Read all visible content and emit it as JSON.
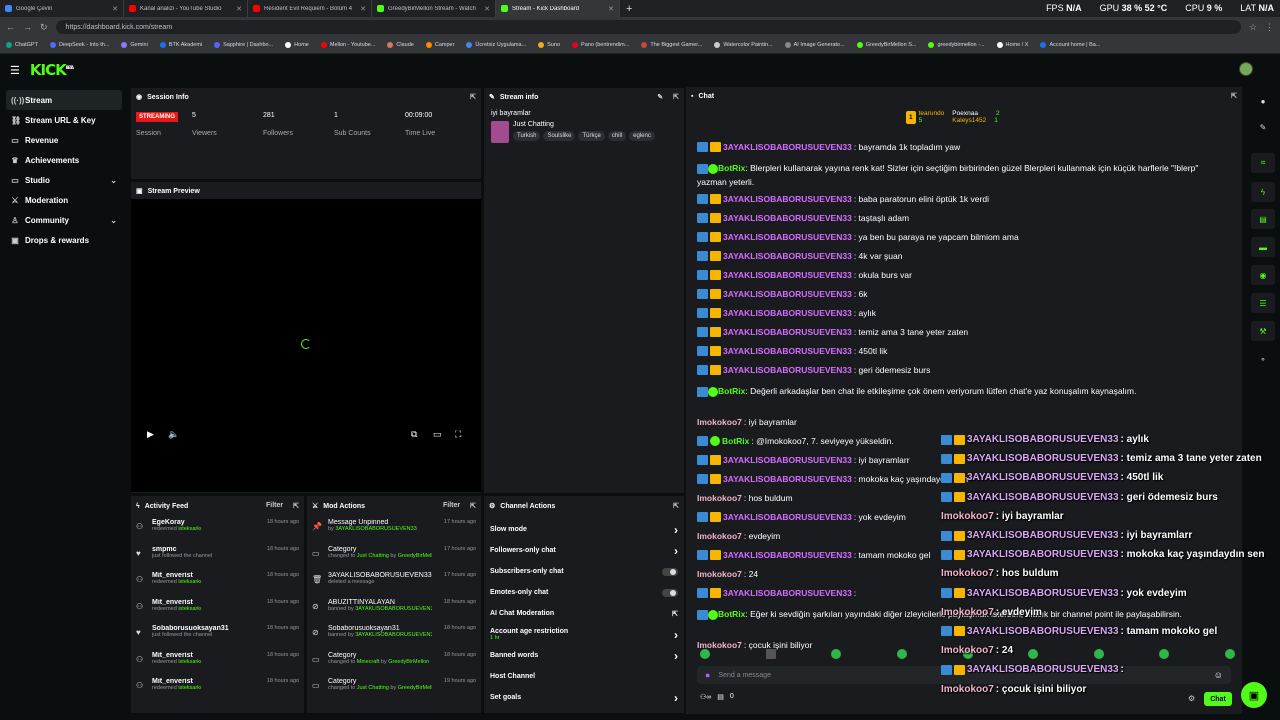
{
  "browser": {
    "tabs": [
      {
        "title": "Google Çeviri",
        "color": "#4285f4",
        "active": false
      },
      {
        "title": "Kanal analizi - YouTube Studio",
        "color": "#ff0000",
        "active": false
      },
      {
        "title": "Resident Evil Requiem - Bölüm 4",
        "color": "#ff0000",
        "active": false
      },
      {
        "title": "GreedyBirMellon Stream - Watch",
        "color": "#53fc18",
        "active": false
      },
      {
        "title": "Stream - Kick Dashboard",
        "color": "#53fc18",
        "active": true
      }
    ],
    "new_tab": "+",
    "url": "https://dashboard.kick.com/stream",
    "bookmarks": [
      "ChatGPT",
      "DeepSeek - Into th...",
      "Gemini",
      "BTK Akademi",
      "Sapphire | Dashbo...",
      "Home",
      "Mellon - Youtube...",
      "Claude",
      "Camper",
      "Ücretsiz Uygulama...",
      "Suno",
      "Pano (bentrendim...",
      "The Biggest Gamer...",
      "Watercolor Paintin...",
      "AI Image Generato...",
      "GreedyBirMellon S...",
      "greedybirmellon -...",
      "Home / X",
      "Account home | Ba..."
    ]
  },
  "system_stats": {
    "fps_label": "FPS",
    "fps": "N/A",
    "gpu_label": "GPU",
    "gpu": "38 % 52 °C",
    "cpu_label": "CPU",
    "cpu": "9 %",
    "lat_label": "LAT",
    "lat": "N/A"
  },
  "brand": {
    "logo": "KICK",
    "beta": "BETA",
    "accent": "#53fc18"
  },
  "sidebar": {
    "items": [
      {
        "label": "Stream",
        "icon": "broadcast-icon",
        "glyph": "((·))",
        "active": true
      },
      {
        "label": "Stream URL & Key",
        "icon": "link-icon",
        "glyph": "⛓"
      },
      {
        "label": "Revenue",
        "icon": "wallet-icon",
        "glyph": "▭"
      },
      {
        "label": "Achievements",
        "icon": "trophy-icon",
        "glyph": "♛"
      },
      {
        "label": "Studio",
        "icon": "video-icon",
        "glyph": "▭",
        "expandable": true
      },
      {
        "label": "Moderation",
        "icon": "sword-icon",
        "glyph": "⚔"
      },
      {
        "label": "Community",
        "icon": "people-icon",
        "glyph": "♙",
        "expandable": true
      },
      {
        "label": "Drops & rewards",
        "icon": "gift-icon",
        "glyph": "▣"
      }
    ]
  },
  "session_info": {
    "title": "Session Info",
    "status": "STREAMING",
    "status_label": "Session",
    "stats": [
      {
        "value": "5",
        "label": "Viewers"
      },
      {
        "value": "281",
        "label": "Followers"
      },
      {
        "value": "1",
        "label": "Sub Counts"
      },
      {
        "value": "00:09:00",
        "label": "Time Live"
      }
    ]
  },
  "stream_info": {
    "title": "Stream info",
    "stream_title": "iyi bayramlar",
    "category": "Just Chatting",
    "tags": [
      "Turkish",
      "Soulslike",
      "Türkçe",
      "chill",
      "eglenc"
    ]
  },
  "stream_preview": {
    "title": "Stream Preview"
  },
  "activity_feed": {
    "title": "Activity Feed",
    "filter": "Filter",
    "items": [
      {
        "name": "EgeKoray",
        "action": "redeemed",
        "detail": "isteksarkı",
        "time": "18 hours ago",
        "icon": "redeem-icon"
      },
      {
        "name": "smpmc",
        "action": "just followed the channel",
        "detail": "",
        "time": "18 hours ago",
        "icon": "heart-icon"
      },
      {
        "name": "Mit_enverist",
        "action": "redeemed",
        "detail": "isteksarkı",
        "time": "18 hours ago",
        "icon": "redeem-icon"
      },
      {
        "name": "Mit_enverist",
        "action": "redeemed",
        "detail": "isteksarkı",
        "time": "18 hours ago",
        "icon": "redeem-icon"
      },
      {
        "name": "Sobaborusuoksayan31",
        "action": "just followed the channel",
        "detail": "",
        "time": "18 hours ago",
        "icon": "heart-icon"
      },
      {
        "name": "Mit_enverist",
        "action": "redeemed",
        "detail": "isteksarkı",
        "time": "18 hours ago",
        "icon": "redeem-icon"
      },
      {
        "name": "Mit_enverist",
        "action": "redeemed",
        "detail": "isteksarkı",
        "time": "18 hours ago",
        "icon": "redeem-icon"
      }
    ]
  },
  "mod_actions": {
    "title": "Mod Actions",
    "filter": "Filter",
    "items": [
      {
        "name": "Message Unpinned",
        "pre": "by",
        "detail": "3AYAKLISOBABORUSUEVEN33",
        "mid": "",
        "detail2": "",
        "time": "17 hours ago"
      },
      {
        "name": "Category",
        "pre": "changed to",
        "detail": "Just Chatting",
        "mid": "by",
        "detail2": "GreedyBirMellon",
        "time": "17 hours ago"
      },
      {
        "name": "3AYAKLISOBABORUSUEVEN33",
        "pre": "deleted a message",
        "detail": "",
        "mid": "",
        "detail2": "",
        "time": "17 hours ago"
      },
      {
        "name": "ABUZITTINYALAYAN",
        "pre": "banned by",
        "detail": "3AYAKLISOBABORUSUEVEN33",
        "mid": "",
        "detail2": "",
        "time": "18 hours ago"
      },
      {
        "name": "Sobaborusuoksayan31",
        "pre": "banned by",
        "detail": "3AYAKLISOBABORUSUEVEN33",
        "mid": "",
        "detail2": "",
        "time": "18 hours ago"
      },
      {
        "name": "Category",
        "pre": "changed to",
        "detail": "Minecraft",
        "mid": "by",
        "detail2": "GreedyBirMellon",
        "time": "18 hours ago"
      },
      {
        "name": "Category",
        "pre": "changed to",
        "detail": "Just Chatting",
        "mid": "by",
        "detail2": "GreedyBirMellon",
        "time": "19 hours ago"
      }
    ]
  },
  "channel_actions": {
    "title": "Channel Actions",
    "items": [
      {
        "label": "Slow mode",
        "type": "chevron",
        "sub": ""
      },
      {
        "label": "Followers-only chat",
        "type": "chevron",
        "sub": ""
      },
      {
        "label": "Subscribers-only chat",
        "type": "toggle",
        "sub": ""
      },
      {
        "label": "Emotes-only chat",
        "type": "toggle",
        "sub": ""
      },
      {
        "label": "AI Chat Moderation",
        "type": "external",
        "sub": ""
      },
      {
        "label": "Account age restriction",
        "type": "chevron",
        "sub": "1 hr"
      },
      {
        "label": "Banned words",
        "type": "chevron",
        "sub": ""
      },
      {
        "label": "Host Channel",
        "type": "none",
        "sub": ""
      },
      {
        "label": "Set goals",
        "type": "chevron",
        "sub": ""
      }
    ]
  },
  "chat": {
    "title": "Chat",
    "leaderboard": [
      {
        "name": "tearundo",
        "score": "5",
        "rank": "1"
      },
      {
        "name": "Poexnaa",
        "score": "2"
      },
      {
        "name": "Kaleys1452",
        "score": "1"
      }
    ],
    "messages": [
      {
        "user": "3AYAKLISOBABORUSUEVEN33",
        "text": ": bayramda 1k topladım yaw",
        "type": "mod"
      },
      {
        "user": "BotRix",
        "text": ": Blerpleri kullanarak yayına renk kat! Sizler için seçtiğim birbirinden güzel Blerpleri kullanmak için küçük harflerle \"!blerp\" yazman yeterli.",
        "type": "bot"
      },
      {
        "user": "3AYAKLISOBABORUSUEVEN33",
        "text": ": baba paratorun elini öptük 1k verdi",
        "type": "mod"
      },
      {
        "user": "3AYAKLISOBABORUSUEVEN33",
        "text": ": taştaşlı adam",
        "type": "mod"
      },
      {
        "user": "3AYAKLISOBABORUSUEVEN33",
        "text": ": ya ben bu paraya ne yapcam bilmiom ama",
        "type": "mod"
      },
      {
        "user": "3AYAKLISOBABORUSUEVEN33",
        "text": ": 4k var şuan",
        "type": "mod"
      },
      {
        "user": "3AYAKLISOBABORUSUEVEN33",
        "text": ": okula burs var",
        "type": "mod"
      },
      {
        "user": "3AYAKLISOBABORUSUEVEN33",
        "text": ": 6k",
        "type": "mod"
      },
      {
        "user": "3AYAKLISOBABORUSUEVEN33",
        "text": ": aylık",
        "type": "mod"
      },
      {
        "user": "3AYAKLISOBABORUSUEVEN33",
        "text": ": temiz ama 3 tane yeter zaten",
        "type": "mod"
      },
      {
        "user": "3AYAKLISOBABORUSUEVEN33",
        "text": ": 450tl lik",
        "type": "mod"
      },
      {
        "user": "3AYAKLISOBABORUSUEVEN33",
        "text": ": geri ödemesiz burs",
        "type": "mod"
      },
      {
        "user": "BotRix",
        "text": ": Değerli arkadaşlar ben chat ile etkileşime çok önem veriyorum lütfen chat'e yaz konuşalım kaynaşalım.",
        "type": "bot"
      },
      {
        "user": "Imokokoo7",
        "text": ": iyi bayramlar",
        "type": "plain"
      },
      {
        "user": "BotRix",
        "text": ": @Imokokoo7, 7. seviyeye yükseldin.",
        "type": "bot"
      },
      {
        "user": "3AYAKLISOBABORUSUEVEN33",
        "text": ": iyi bayramlarr",
        "type": "mod"
      },
      {
        "user": "3AYAKLISOBABORUSUEVEN33",
        "text": ": mokoka kaç yaşındaydın sen",
        "type": "mod"
      },
      {
        "user": "Imokokoo7",
        "text": ": hos buldum",
        "type": "plain"
      },
      {
        "user": "3AYAKLISOBABORUSUEVEN33",
        "text": ": yok evdeyim",
        "type": "mod"
      },
      {
        "user": "Imokokoo7",
        "text": ": evdeyim",
        "type": "plain"
      },
      {
        "user": "3AYAKLISOBABORUSUEVEN33",
        "text": ": tamam mokoko gel",
        "type": "mod"
      },
      {
        "user": "Imokokoo7",
        "text": ": 24",
        "type": "plain"
      },
      {
        "user": "3AYAKLISOBABORUSUEVEN33",
        "text": ":",
        "type": "mod"
      },
      {
        "user": "BotRix",
        "text": ": Eğer ki sevdiğin şarkıları yayındaki diğer izleyicilerle paylaşmak istersen, ufacık bir channel point ile paylaşabilirsin.",
        "type": "bot"
      },
      {
        "user": "Imokokoo7",
        "text": ": çocuk işini biliyor",
        "type": "plain"
      }
    ],
    "input_placeholder": "Send a message",
    "viewer_count": "0",
    "chat_button": "Chat"
  },
  "overlay": {
    "rows": [
      {
        "user": "3AYAKLISOBABORUSUEVEN33",
        "text": " : aylık",
        "type": "mod"
      },
      {
        "user": "3AYAKLISOBABORUSUEVEN33",
        "text": " : temiz ama 3 tane yeter zaten",
        "type": "mod"
      },
      {
        "user": "3AYAKLISOBABORUSUEVEN33",
        "text": " : 450tl lik",
        "type": "mod"
      },
      {
        "user": "3AYAKLISOBABORUSUEVEN33",
        "text": " : geri ödemesiz burs",
        "type": "mod"
      },
      {
        "user": "Imokokoo7",
        "text": " : iyi bayramlar",
        "type": "plain"
      },
      {
        "user": "3AYAKLISOBABORUSUEVEN33",
        "text": " : iyi bayramlarr",
        "type": "mod"
      },
      {
        "user": "3AYAKLISOBABORUSUEVEN33",
        "text": " : mokoka kaç yaşındaydın sen",
        "type": "mod"
      },
      {
        "user": "Imokokoo7",
        "text": " : hos buldum",
        "type": "plain"
      },
      {
        "user": "3AYAKLISOBABORUSUEVEN33",
        "text": " : yok evdeyim",
        "type": "mod"
      },
      {
        "user": "Imokokoo7",
        "text": " : evdeyim",
        "type": "plain"
      },
      {
        "user": "3AYAKLISOBABORUSUEVEN33",
        "text": " : tamam mokoko gel",
        "type": "mod"
      },
      {
        "user": "Imokokoo7",
        "text": " : 24",
        "type": "plain"
      },
      {
        "user": "3AYAKLISOBABORUSUEVEN33",
        "text": " :",
        "type": "mod"
      },
      {
        "user": "Imokokoo7",
        "text": " : çocuk işini biliyor",
        "type": "plain"
      }
    ]
  }
}
